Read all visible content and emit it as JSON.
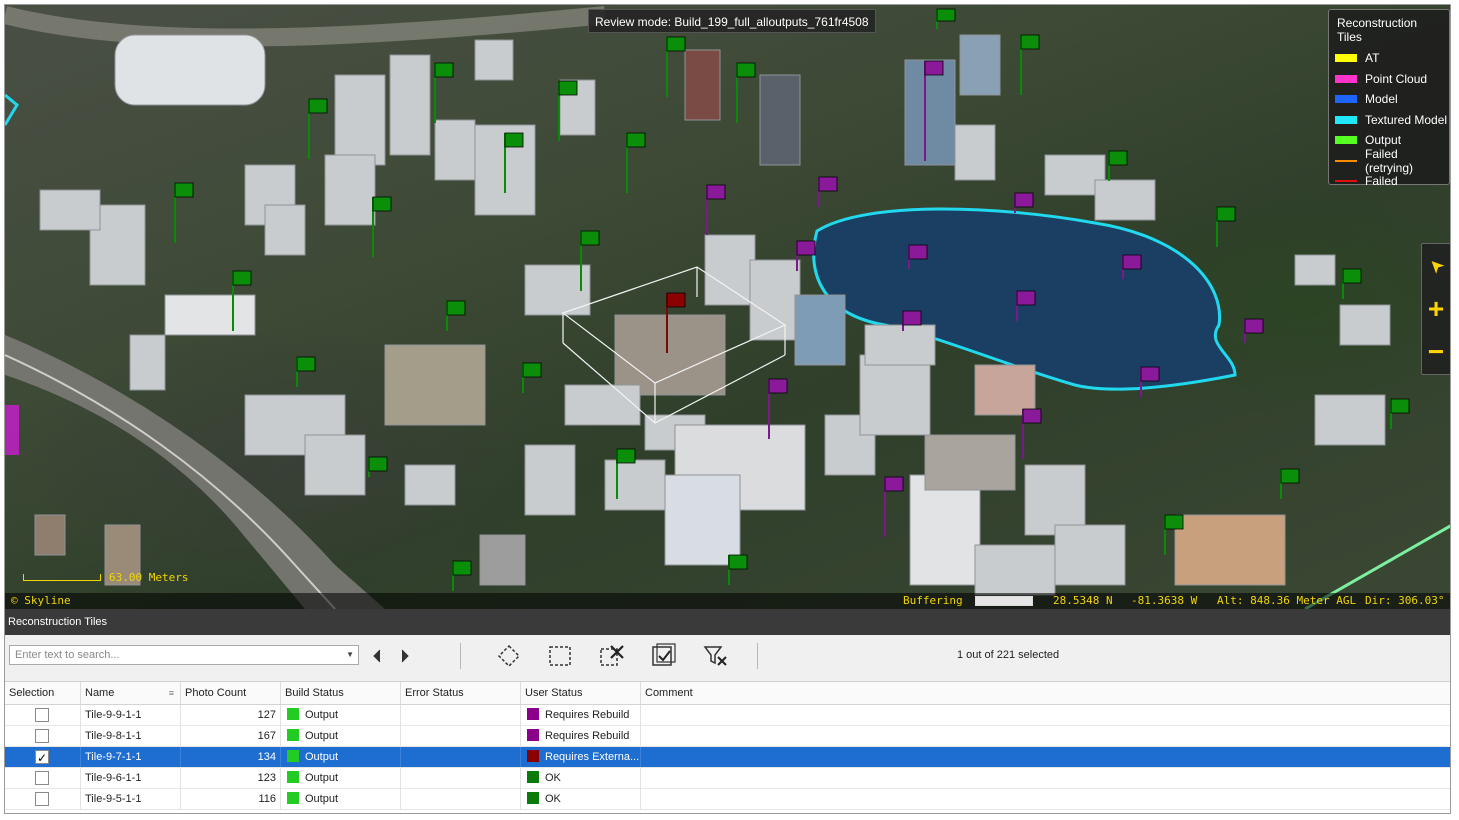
{
  "map": {
    "review_label": "Review mode: Build_199_full_alloutputs_761fr4508",
    "legend": {
      "title": "Reconstruction Tiles",
      "items": [
        {
          "label": "AT",
          "color": "#ffff00",
          "kind": "swatch"
        },
        {
          "label": "Point Cloud",
          "color": "#ff33cc",
          "kind": "swatch"
        },
        {
          "label": "Model",
          "color": "#1e64ff",
          "kind": "swatch"
        },
        {
          "label": "Textured Model",
          "color": "#22e8ff",
          "kind": "swatch"
        },
        {
          "label": "Output",
          "color": "#55ff22",
          "kind": "swatch"
        },
        {
          "label": "Failed (retrying)",
          "color": "#ff8c00",
          "kind": "line"
        },
        {
          "label": "Failed",
          "color": "#e01010",
          "kind": "line"
        }
      ]
    },
    "scale_text": "63.00 Meters",
    "copyright": "© Skyline",
    "status": {
      "buffering": "Buffering",
      "lat": "28.5348 N",
      "lon": "-81.3638 W",
      "alt": "Alt: 848.36 Meter AGL",
      "dir": "Dir: 306.03°"
    },
    "nav": {
      "north": "➤",
      "zoom_in": "+",
      "zoom_out": "−"
    }
  },
  "panel": {
    "title": "Reconstruction Tiles",
    "search_placeholder": "Enter text to search...",
    "selected_text": "1 out of 221 selected",
    "columns": {
      "selection": "Selection",
      "name": "Name",
      "photo_count": "Photo Count",
      "build_status": "Build Status",
      "error_status": "Error Status",
      "user_status": "User Status",
      "comment": "Comment"
    },
    "rows": [
      {
        "name": "Tile-9-9-1-1",
        "photo_count": "127",
        "build_status": "Output",
        "build_color": "#22cc22",
        "user_status": "Requires Rebuild",
        "user_color": "#8b008b",
        "checked": false
      },
      {
        "name": "Tile-9-8-1-1",
        "photo_count": "167",
        "build_status": "Output",
        "build_color": "#22cc22",
        "user_status": "Requires Rebuild",
        "user_color": "#8b008b",
        "checked": false
      },
      {
        "name": "Tile-9-7-1-1",
        "photo_count": "134",
        "build_status": "Output",
        "build_color": "#22cc22",
        "user_status": "Requires Externa...",
        "user_color": "#8b0000",
        "checked": true
      },
      {
        "name": "Tile-9-6-1-1",
        "photo_count": "123",
        "build_status": "Output",
        "build_color": "#22cc22",
        "user_status": "OK",
        "user_color": "#0a7a0a",
        "checked": false
      },
      {
        "name": "Tile-9-5-1-1",
        "photo_count": "116",
        "build_status": "Output",
        "build_color": "#22cc22",
        "user_status": "OK",
        "user_color": "#0a7a0a",
        "checked": false
      }
    ]
  }
}
